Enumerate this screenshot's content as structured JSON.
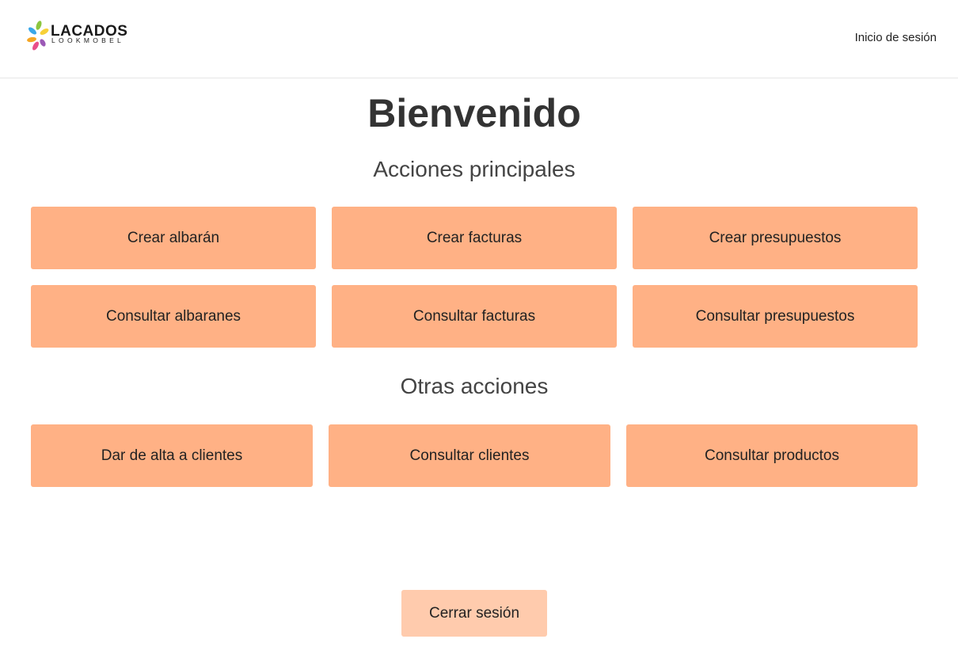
{
  "brand": {
    "name": "LACADOS",
    "tagline": "LOOKMOBEL",
    "colors": [
      "#3aa7e8",
      "#8cc63f",
      "#f5a623",
      "#e94e8a",
      "#9b59b6",
      "#f7d038"
    ]
  },
  "header": {
    "login_link": "Inicio de sesión"
  },
  "page": {
    "title": "Bienvenido"
  },
  "main_actions": {
    "title": "Acciones principales",
    "buttons": [
      "Crear albarán",
      "Crear facturas",
      "Crear presupuestos",
      "Consultar albaranes",
      "Consultar facturas",
      "Consultar presupuestos"
    ]
  },
  "other_actions": {
    "title": "Otras acciones",
    "buttons": [
      "Dar de alta a clientes",
      "Consultar clientes",
      "Consultar productos"
    ]
  },
  "footer": {
    "logout_label": "Cerrar sesión"
  },
  "theme": {
    "button_color": "#ffb185",
    "logout_color": "#ffcbad"
  }
}
